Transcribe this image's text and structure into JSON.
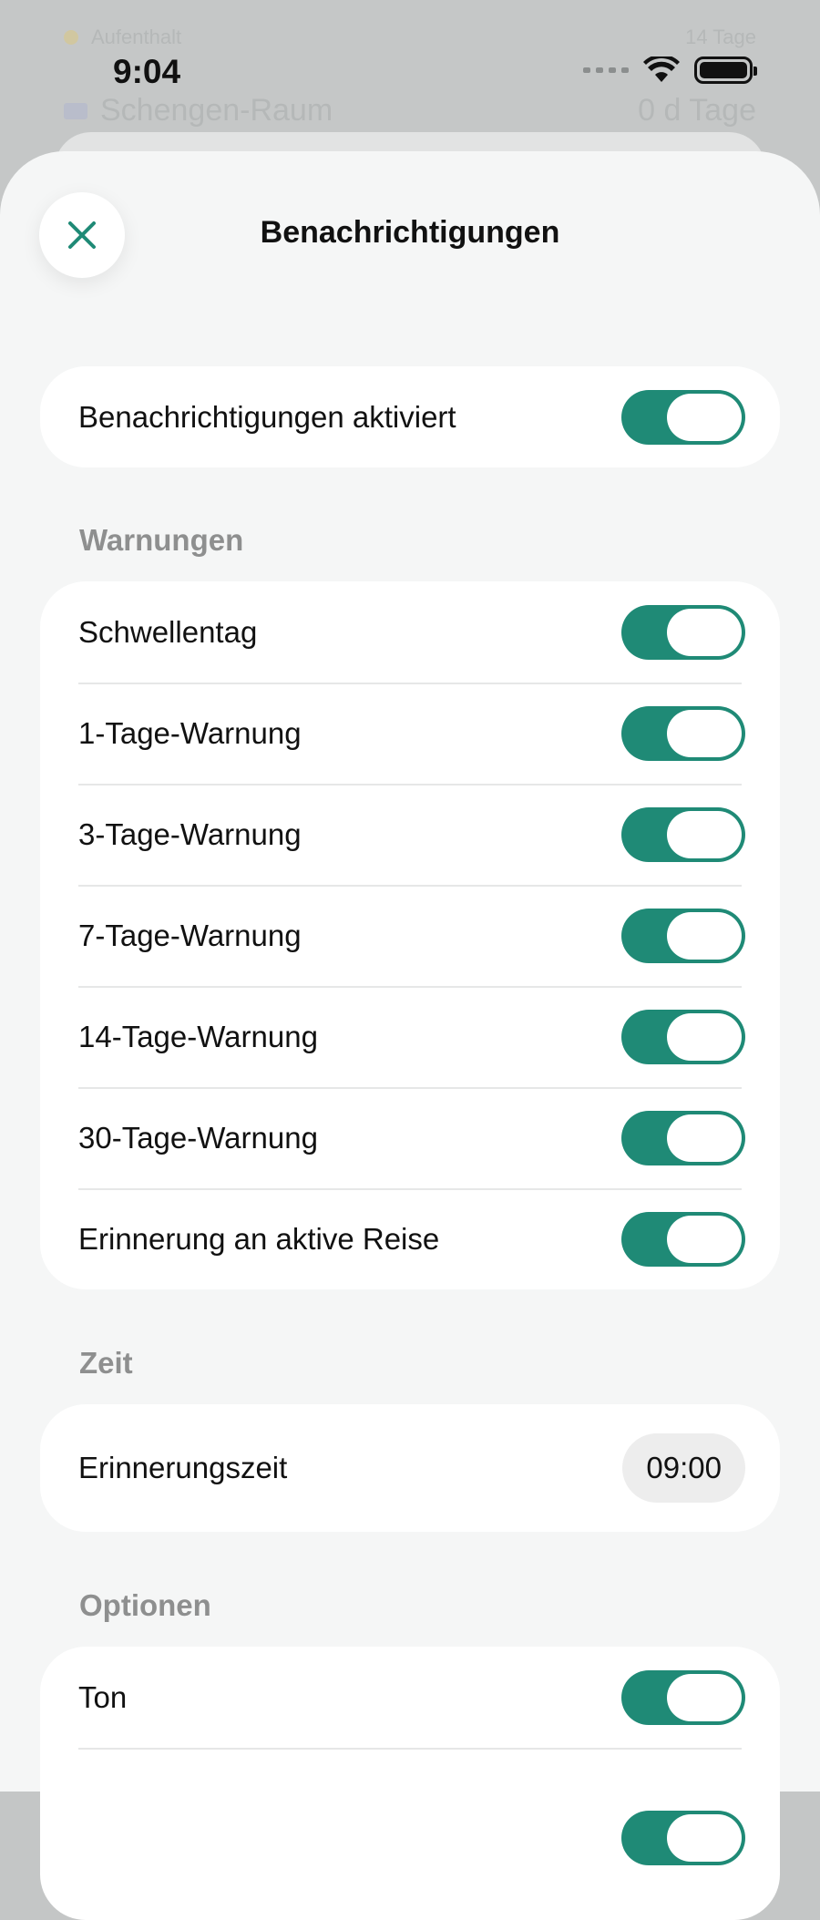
{
  "background": {
    "row1": {
      "label": "Aufenthalt",
      "value": "14 Tage"
    },
    "row2": {
      "label": "Schengen-Raum",
      "value": "0 d Tage"
    }
  },
  "status_bar": {
    "time": "9:04"
  },
  "sheet": {
    "title": "Benachrichtigungen",
    "close_icon": "close-icon"
  },
  "master": {
    "label": "Benachrichtigungen aktiviert",
    "enabled": true
  },
  "warnings": {
    "header": "Warnungen",
    "items": [
      {
        "label": "Schwellentag",
        "enabled": true
      },
      {
        "label": "1-Tage-Warnung",
        "enabled": true
      },
      {
        "label": "3-Tage-Warnung",
        "enabled": true
      },
      {
        "label": "7-Tage-Warnung",
        "enabled": true
      },
      {
        "label": "14-Tage-Warnung",
        "enabled": true
      },
      {
        "label": "30-Tage-Warnung",
        "enabled": true
      },
      {
        "label": "Erinnerung an aktive Reise",
        "enabled": true
      }
    ]
  },
  "time_section": {
    "header": "Zeit",
    "label": "Erinnerungszeit",
    "value": "09:00"
  },
  "options": {
    "header": "Optionen",
    "items": [
      {
        "label": "Ton",
        "enabled": true
      }
    ]
  },
  "colors": {
    "accent": "#1f8a76",
    "sheet_bg": "#f5f6f6",
    "card_bg": "#ffffff",
    "section_header": "#8e8f8f"
  }
}
